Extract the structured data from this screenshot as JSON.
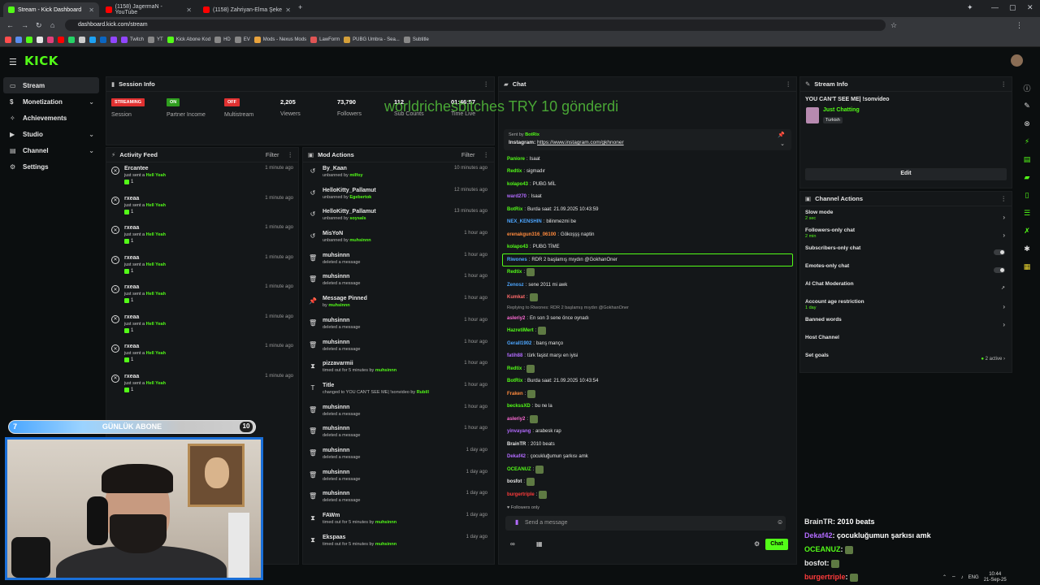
{
  "browser": {
    "tabs": [
      {
        "title": "Stream - Kick Dashboard",
        "color": "#53fc18"
      },
      {
        "title": "(1158) JagermaN - YouTube",
        "color": "#ff0000"
      },
      {
        "title": "(1158) Zahriyan-Elma Şeke",
        "color": "#ff0000"
      }
    ],
    "url": "dashboard.kick.com/stream",
    "bookmarks": [
      "Twitch",
      "YT",
      "Kick Abone Kod",
      "HD",
      "EV",
      "Mods - Nexus Mods",
      "LawForm",
      "PUBG Umbra - Sea...",
      "Subtitle"
    ]
  },
  "header": {
    "logo": "KICK"
  },
  "nav": {
    "items": [
      {
        "label": "Stream",
        "icon": "▭"
      },
      {
        "label": "Monetization",
        "icon": "$"
      },
      {
        "label": "Achievements",
        "icon": "✧"
      },
      {
        "label": "Studio",
        "icon": "▶"
      },
      {
        "label": "Channel",
        "icon": "▤"
      },
      {
        "label": "Settings",
        "icon": "⚙"
      }
    ]
  },
  "session": {
    "title": "Session Info",
    "streaming_badge": "STREAMING",
    "session_label": "Session",
    "on_badge": "ON",
    "partner_income_label": "Partner Income",
    "off_badge": "OFF",
    "multistream_label": "Multistream",
    "viewers": "2,205",
    "viewers_label": "Viewers",
    "followers": "73,790",
    "followers_label": "Followers",
    "subs": "112",
    "subs_label": "Sub Counts",
    "time": "01:46:57",
    "time_label": "Time Live"
  },
  "overlay_text": "worldrichesbitches TRY 10 gönderdi",
  "activity": {
    "title": "Activity Feed",
    "filter": "Filter",
    "rows": [
      {
        "name": "Ercantee",
        "sub": "just sent a",
        "item": "Hell Yeah",
        "count": "1",
        "time": "1 minute ago"
      },
      {
        "name": "rxeaa",
        "sub": "just sent a",
        "item": "Hell Yeah",
        "count": "1",
        "time": "1 minute ago"
      },
      {
        "name": "rxeaa",
        "sub": "just sent a",
        "item": "Hell Yeah",
        "count": "1",
        "time": "1 minute ago"
      },
      {
        "name": "rxeaa",
        "sub": "just sent a",
        "item": "Hell Yeah",
        "count": "1",
        "time": "1 minute ago"
      },
      {
        "name": "rxeaa",
        "sub": "just sent a",
        "item": "Hell Yeah",
        "count": "1",
        "time": "1 minute ago"
      },
      {
        "name": "rxeaa",
        "sub": "just sent a",
        "item": "Hell Yeah",
        "count": "1",
        "time": "1 minute ago"
      },
      {
        "name": "rxeaa",
        "sub": "just sent a",
        "item": "Hell Yeah",
        "count": "1",
        "time": "1 minute ago"
      },
      {
        "name": "rxeaa",
        "sub": "just sent a",
        "item": "Hell Yeah",
        "count": "1",
        "time": "1 minute ago"
      }
    ]
  },
  "mod": {
    "title": "Mod Actions",
    "filter": "Filter",
    "rows": [
      {
        "icon": "↺",
        "name": "By_Kaan",
        "sub": "unbanned by",
        "who": "milfoy",
        "time": "10 minutes ago"
      },
      {
        "icon": "↺",
        "name": "HelloKitty_Pallamut",
        "sub": "unbanned by",
        "who": "Egebertok",
        "time": "12 minutes ago"
      },
      {
        "icon": "↺",
        "name": "HelloKitty_Pallamut",
        "sub": "unbanned by",
        "who": "soysals",
        "time": "13 minutes ago"
      },
      {
        "icon": "↺",
        "name": "MisYoN",
        "sub": "unbanned by",
        "who": "muhsinnn",
        "time": "1 hour ago"
      },
      {
        "icon": "🗑",
        "name": "muhsinnn",
        "sub": "deleted a message",
        "who": "",
        "time": "1 hour ago"
      },
      {
        "icon": "🗑",
        "name": "muhsinnn",
        "sub": "deleted a message",
        "who": "",
        "time": "1 hour ago"
      },
      {
        "icon": "📌",
        "name": "Message Pinned",
        "sub": "by",
        "who": "muhsinnn",
        "time": "1 hour ago"
      },
      {
        "icon": "🗑",
        "name": "muhsinnn",
        "sub": "deleted a message",
        "who": "",
        "time": "1 hour ago"
      },
      {
        "icon": "🗑",
        "name": "muhsinnn",
        "sub": "deleted a message",
        "who": "",
        "time": "1 hour ago"
      },
      {
        "icon": "⧗",
        "name": "pizzavarmii",
        "sub": "timed out for 5 minutes by",
        "who": "muhsinnn",
        "time": "1 hour ago"
      },
      {
        "icon": "T",
        "name": "Title",
        "sub": "changed to YOU CAN'T SEE ME| !sonvideo by",
        "who": "Rubill",
        "time": "1 hour ago"
      },
      {
        "icon": "🗑",
        "name": "muhsinnn",
        "sub": "deleted a message",
        "who": "",
        "time": "1 hour ago"
      },
      {
        "icon": "🗑",
        "name": "muhsinnn",
        "sub": "deleted a message",
        "who": "",
        "time": "1 hour ago"
      },
      {
        "icon": "🗑",
        "name": "muhsinnn",
        "sub": "deleted a message",
        "who": "",
        "time": "1 day ago"
      },
      {
        "icon": "🗑",
        "name": "muhsinnn",
        "sub": "deleted a message",
        "who": "",
        "time": "1 day ago"
      },
      {
        "icon": "🗑",
        "name": "muhsinnn",
        "sub": "deleted a message",
        "who": "",
        "time": "1 day ago"
      },
      {
        "icon": "⧗",
        "name": "FAWm",
        "sub": "timed out for 5 minutes by",
        "who": "muhsinnn",
        "time": "1 day ago"
      },
      {
        "icon": "⧗",
        "name": "Ekspaas",
        "sub": "timed out for 5 minutes by",
        "who": "muhsinnn",
        "time": "1 day ago"
      }
    ]
  },
  "chat": {
    "title": "Chat",
    "pinned_by": "Sent by",
    "pinned_user": "BotRix",
    "pinned_text": "Instagram:",
    "pinned_link": "https://www.instagram.com/gkhnoner",
    "messages": [
      {
        "user": "Paniore",
        "color": "#53fc18",
        "text": "Isaat"
      },
      {
        "user": "Redtix",
        "color": "#53fc18",
        "text": "sigmadır"
      },
      {
        "user": "kolapo43",
        "color": "#53fc18",
        "text": "PUBG MİL"
      },
      {
        "user": "ward270",
        "color": "#b36bff",
        "text": "Isaat"
      },
      {
        "user": "BotRix",
        "color": "#53fc18",
        "text": "Burda saat: 21.09.2025 10:43:59"
      },
      {
        "user": "NEX_KENSHIN",
        "color": "#4da6ff",
        "text": "bilinmezmi be"
      },
      {
        "user": "erenakgun316_06100",
        "color": "#ff8a3d",
        "text": "Gökoşşş naptin"
      },
      {
        "user": "kolapo43",
        "color": "#53fc18",
        "text": "PUBG TİME"
      },
      {
        "user": "Riwones",
        "color": "#4da6ff",
        "text": "RDR 2 başlamış mıydın @GokhanOner"
      },
      {
        "user": "Redtix",
        "color": "#53fc18",
        "text": ""
      },
      {
        "user": "Zenosz",
        "color": "#4da6ff",
        "text": "sene 2011 mi awk"
      },
      {
        "user": "Kumkat",
        "color": "#ff6b6b",
        "text": ""
      },
      {
        "user": "asleriy2",
        "color": "#ff6bd6",
        "text": "En son 3 sene önce oynadı"
      },
      {
        "user": "HazretiMert",
        "color": "#53fc18",
        "text": ""
      },
      {
        "user": "Gerall1902",
        "color": "#4da6ff",
        "text": "barış manço"
      },
      {
        "user": "fatih88",
        "color": "#b36bff",
        "text": "türk faşist marşı en iyisi"
      },
      {
        "user": "Redtix",
        "color": "#53fc18",
        "text": ""
      },
      {
        "user": "BotRix",
        "color": "#53fc18",
        "text": "Burda saat: 21.09.2025 10:43:54"
      },
      {
        "user": "Fraken",
        "color": "#ff8a3d",
        "text": ""
      },
      {
        "user": "beckssXD",
        "color": "#53fc18",
        "text": "bu ne la"
      },
      {
        "user": "asleriy2",
        "color": "#ff6bd6",
        "text": ""
      },
      {
        "user": "yinvayang",
        "color": "#b36bff",
        "text": "arabesk rap"
      },
      {
        "user": "BrainTR",
        "color": "#e6e6e6",
        "text": "2010 beats"
      },
      {
        "user": "Dekaf42",
        "color": "#b36bff",
        "text": "çocukluğumun şarkısı amk"
      },
      {
        "user": "OCEANUZ",
        "color": "#53fc18",
        "text": ""
      },
      {
        "user": "bosfot",
        "color": "#e6e6e6",
        "text": ""
      },
      {
        "user": "burgertriple",
        "color": "#ff3b3b",
        "text": ""
      }
    ],
    "reply_note": "Replying to Riwones: RDR 2 başlamış mıydın @GokhanOner",
    "followers_only": "Followers only",
    "input_placeholder": "Send a message",
    "send_label": "Chat"
  },
  "stream_info": {
    "title": "Stream Info",
    "stream_title": "YOU CAN'T SEE ME| !sonvideo",
    "category": "Just Chatting",
    "language": "Turkish",
    "edit_label": "Edit"
  },
  "channel_actions": {
    "title": "Channel Actions",
    "rows": [
      {
        "label": "Slow mode",
        "sub": "2 sec",
        "kind": "chevron"
      },
      {
        "label": "Followers-only chat",
        "sub": "2 min",
        "kind": "chevron"
      },
      {
        "label": "Subscribers-only chat",
        "sub": "",
        "kind": "toggle"
      },
      {
        "label": "Emotes-only chat",
        "sub": "",
        "kind": "toggle"
      },
      {
        "label": "AI Chat Moderation",
        "sub": "",
        "kind": "ext"
      },
      {
        "label": "Account age restriction",
        "sub": "1 day",
        "kind": "chevron"
      },
      {
        "label": "Banned words",
        "sub": "",
        "kind": "chevron"
      },
      {
        "label": "Host Channel",
        "sub": "",
        "kind": "none"
      },
      {
        "label": "Set goals",
        "sub": "",
        "kind": "goals"
      }
    ],
    "goals_active": "2 active"
  },
  "webcam": {
    "sub_left": "7",
    "sub_title": "GÜNLÜK ABONE",
    "sub_right": "10",
    "sub_progress": 0.7
  },
  "overlay_chat": [
    {
      "user": "BrainTR",
      "color": "#e6e6e6",
      "text": "2010 beats"
    },
    {
      "user": "Dekaf42",
      "color": "#b36bff",
      "text": "çocukluğumun şarkısı amk"
    },
    {
      "user": "OCEANUZ",
      "color": "#53fc18",
      "text": ""
    },
    {
      "user": "bosfot",
      "color": "#e6e6e6",
      "text": ""
    },
    {
      "user": "burgertriple",
      "color": "#ff3b3b",
      "text": ""
    }
  ],
  "taskbar": {
    "lang": "ENG",
    "time": "10:44",
    "date": "21-Sep-25"
  }
}
